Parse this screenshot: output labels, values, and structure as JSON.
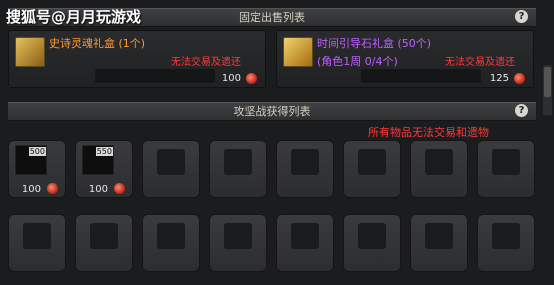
{
  "watermark": "搜狐号@月月玩游戏",
  "fixed_sale": {
    "title": "固定出售列表",
    "help": "?",
    "items": [
      {
        "name": "史诗灵魂礼盒 (1个)",
        "color": "#ff9a2e",
        "restriction": "无法交易及遗还",
        "price": "100",
        "icon": "gold-gift-box-icon"
      },
      {
        "name": "时间引导石礼盒 (50个)",
        "subtitle": "(角色1周 0/4个)",
        "color": "#c060ff",
        "restriction": "无法交易及遗还",
        "price": "125",
        "icon": "golden-chest-icon"
      }
    ]
  },
  "rewards": {
    "title": "攻坚战获得列表",
    "help": "?",
    "notice": "所有物品无法交易和遗物",
    "items": [
      {
        "badge": "500",
        "price": "100"
      },
      {
        "badge": "550",
        "price": "100"
      }
    ]
  }
}
